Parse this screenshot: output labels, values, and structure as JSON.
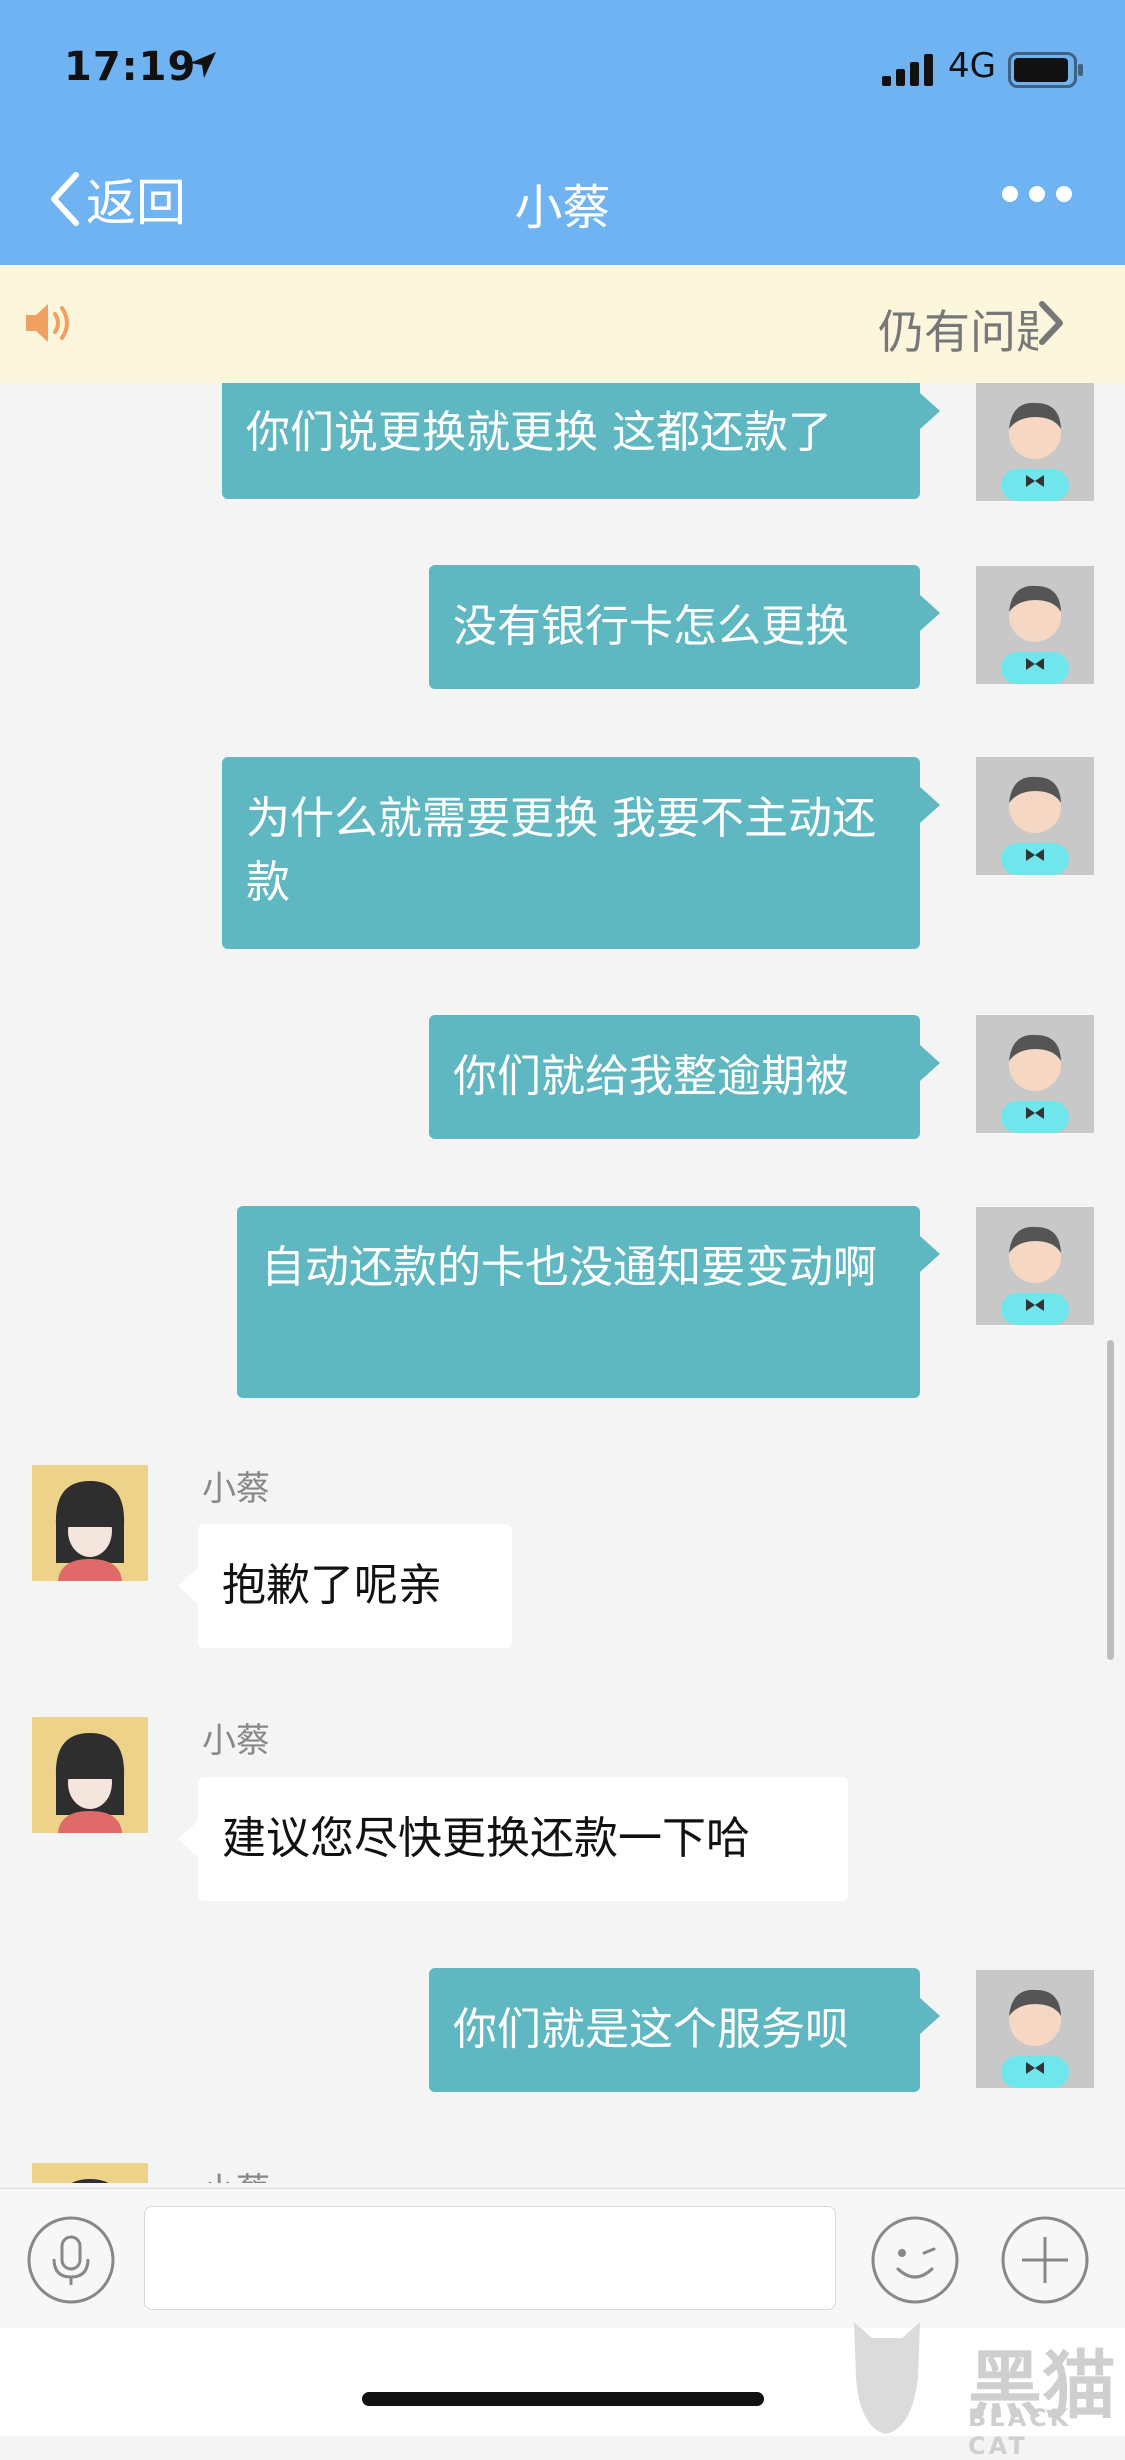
{
  "status_bar": {
    "time": "17:19",
    "network": "4G"
  },
  "nav": {
    "back_label": "返回",
    "title": "小蔡"
  },
  "notice": {
    "text": "仍有问题"
  },
  "messages": [
    {
      "from": "user",
      "text": "你们说更换就更换 这都还款了"
    },
    {
      "from": "user",
      "text": "没有银行卡怎么更换"
    },
    {
      "from": "user",
      "text": "为什么就需要更换 我要不主动还款"
    },
    {
      "from": "user",
      "text": "你们就给我整逾期被"
    },
    {
      "from": "user",
      "text": "自动还款的卡也没通知要变动啊"
    },
    {
      "from": "agent",
      "sender": "小蔡",
      "text": "抱歉了呢亲"
    },
    {
      "from": "agent",
      "sender": "小蔡",
      "text": "建议您尽快更换还款一下哈"
    },
    {
      "from": "user",
      "text": "你们就是这个服务呗"
    },
    {
      "from": "agent",
      "sender": "小蔡",
      "text": ""
    }
  ],
  "input": {
    "value": "",
    "placeholder": ""
  },
  "watermark": {
    "main": "黑猫",
    "sub": "BLACK CAT"
  },
  "colors": {
    "nav_bg": "#6fb3f2",
    "notice_bg": "#fbf6dc",
    "out_bubble": "#5fb7c1",
    "chat_bg": "#f4f4f4"
  },
  "icons": [
    "location-arrow-icon",
    "signal-icon",
    "battery-icon",
    "chevron-left-icon",
    "more-icon",
    "speaker-icon",
    "chevron-right-icon",
    "user-avatar-icon",
    "agent-avatar-icon",
    "microphone-icon",
    "emoji-icon",
    "plus-icon"
  ]
}
